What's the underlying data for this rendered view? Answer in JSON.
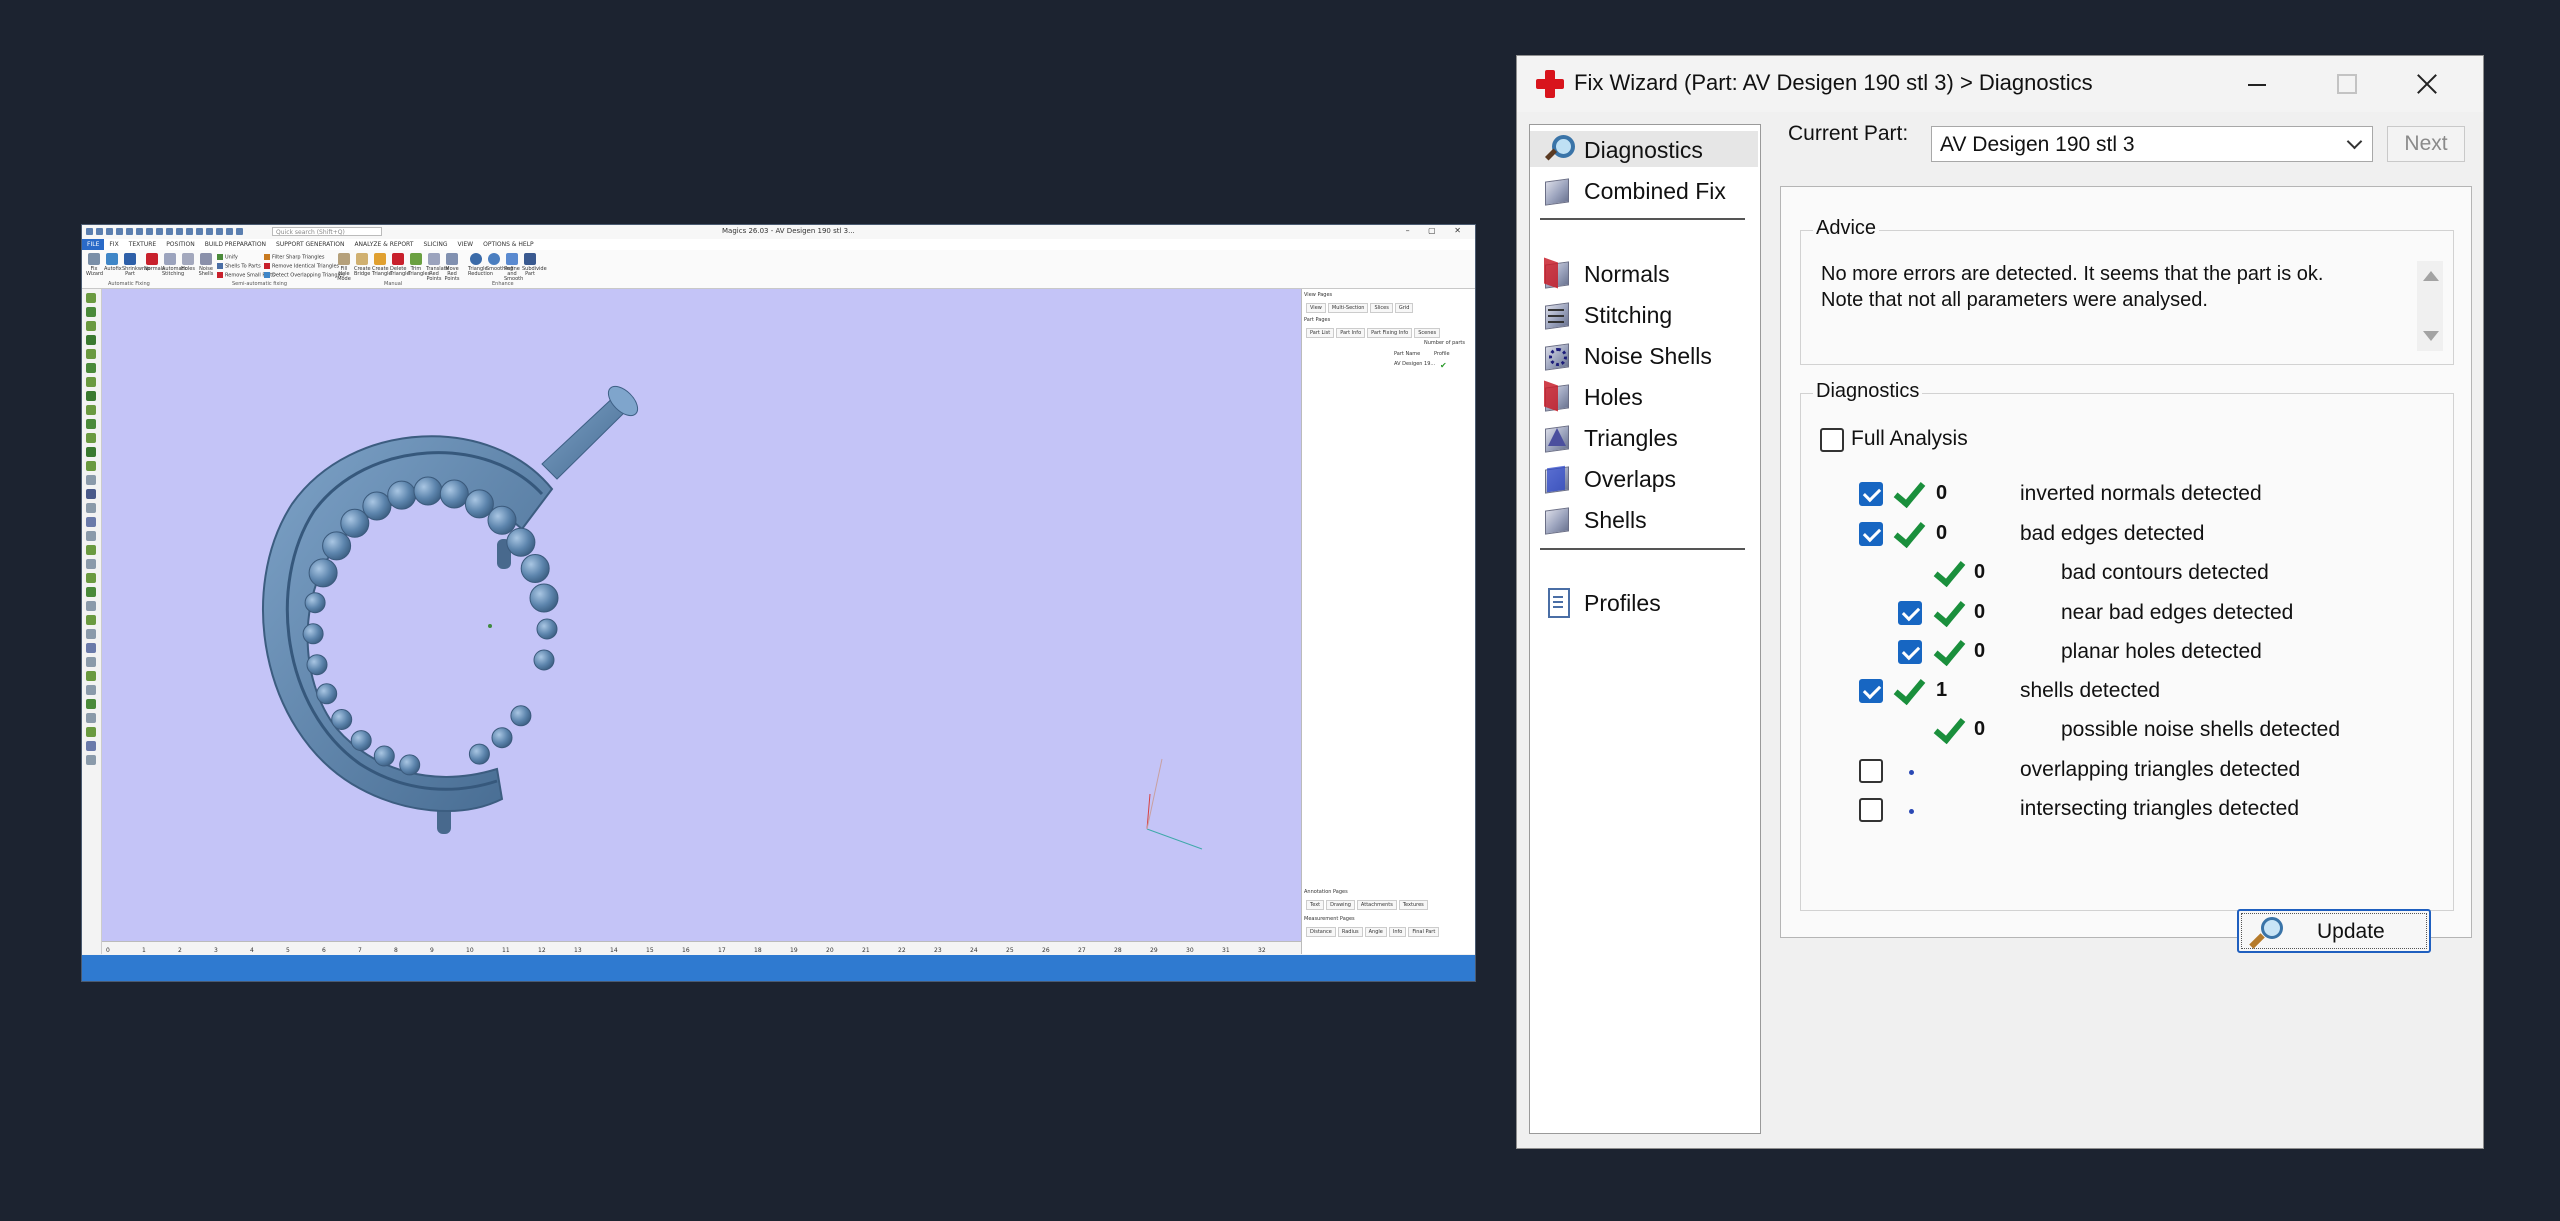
{
  "magics": {
    "title": "Magics 26.03 - AV Desigen 190 stl 3...",
    "search_placeholder": "Quick search (Shift+Q)",
    "menu": [
      "FILE",
      "FIX",
      "TEXTURE",
      "POSITION",
      "BUILD PREPARATION",
      "SUPPORT GENERATION",
      "ANALYZE & REPORT",
      "SLICING",
      "VIEW",
      "OPTIONS & HELP"
    ],
    "ribbon_buttons": [
      "Fix Wizard",
      "Autofix",
      "Shrinkwrap Part",
      "Normals",
      "Automatic Stitching",
      "Holes",
      "Noise Shells",
      "Fill Hole Mode",
      "Create Bridge",
      "Create Triangle",
      "Delete Triangle",
      "Trim Triangles",
      "Translate Red Points",
      "Move Red Points",
      "Triangle Reduction",
      "Smoothing",
      "Refine and Smooth",
      "Subdivide Part"
    ],
    "ribbon_small": [
      "Unify",
      "Shells To Parts",
      "Remove Small Parts",
      "Filter Sharp Triangles",
      "Remove Identical Triangles",
      "Detect Overlapping Triangles"
    ],
    "ribbon_groups": [
      "Automatic Fixing",
      "Semi-automatic fixing",
      "Manual",
      "Enhance"
    ],
    "ruler": [
      "0",
      "1",
      "2",
      "3",
      "4",
      "5",
      "6",
      "7",
      "8",
      "9",
      "10",
      "11",
      "12",
      "13",
      "14",
      "15",
      "16",
      "17",
      "18",
      "19",
      "20",
      "21",
      "22",
      "23",
      "24",
      "25",
      "26",
      "27",
      "28",
      "29",
      "30",
      "31",
      "32"
    ],
    "ruler_unit": "mm",
    "right_panel": {
      "view_pages": "View Pages",
      "view_tabs": [
        "View",
        "Multi-Section",
        "Slices",
        "Grid"
      ],
      "part_pages": "Part Pages",
      "part_tabs": [
        "Part List",
        "Part Info",
        "Part Fixing Info",
        "Scenes"
      ],
      "columns": [
        "Part Name",
        "Profile"
      ],
      "number_of_parts": "Number of parts",
      "part_name": "AV Desigen 19...",
      "annotation_pages": "Annotation Pages",
      "annotation_tabs": [
        "Text",
        "Drawing",
        "Attachments",
        "Textures"
      ],
      "measurement_pages": "Measurement Pages",
      "measure_tabs": [
        "Distance",
        "Radius",
        "Angle",
        "Info",
        "Final Part"
      ]
    }
  },
  "fixwiz": {
    "title": "Fix Wizard (Part: AV Desigen 190 stl 3) > Diagnostics",
    "nav": [
      {
        "label": "Diagnostics",
        "icon": "magnifier-icon"
      },
      {
        "label": "Combined Fix",
        "icon": "layers-icon"
      },
      {
        "label": "Normals",
        "icon": "normals-icon"
      },
      {
        "label": "Stitching",
        "icon": "stitching-icon"
      },
      {
        "label": "Noise Shells",
        "icon": "noise-shells-icon"
      },
      {
        "label": "Holes",
        "icon": "holes-icon"
      },
      {
        "label": "Triangles",
        "icon": "triangles-icon"
      },
      {
        "label": "Overlaps",
        "icon": "overlaps-icon"
      },
      {
        "label": "Shells",
        "icon": "shells-icon"
      },
      {
        "label": "Profiles",
        "icon": "document-icon"
      }
    ],
    "current_part_label": "Current Part:",
    "current_part_value": "AV Desigen 190 stl 3",
    "next_label": "Next",
    "advice_title": "Advice",
    "advice_lines": [
      "No more errors are detected. It seems that the part is ok.",
      "Note that not all parameters were analysed."
    ],
    "diagnostics_title": "Diagnostics",
    "full_analysis_label": "Full Analysis",
    "rows": [
      {
        "count": "0",
        "label": "inverted normals detected"
      },
      {
        "count": "0",
        "label": "bad edges detected"
      },
      {
        "count": "0",
        "label": "bad contours detected"
      },
      {
        "count": "0",
        "label": "near bad edges detected"
      },
      {
        "count": "0",
        "label": "planar holes detected"
      },
      {
        "count": "1",
        "label": "shells detected"
      },
      {
        "count": "0",
        "label": "possible noise shells detected"
      },
      {
        "count": "",
        "label": "overlapping triangles detected"
      },
      {
        "count": "",
        "label": "intersecting triangles detected"
      }
    ],
    "update_label": "Update",
    "colors": {
      "accent": "#1766c2",
      "ok_green": "#1a8f3c",
      "brand_red": "#d8141c",
      "viewport": "#c4c4f7",
      "part": "#5f86ad"
    }
  }
}
